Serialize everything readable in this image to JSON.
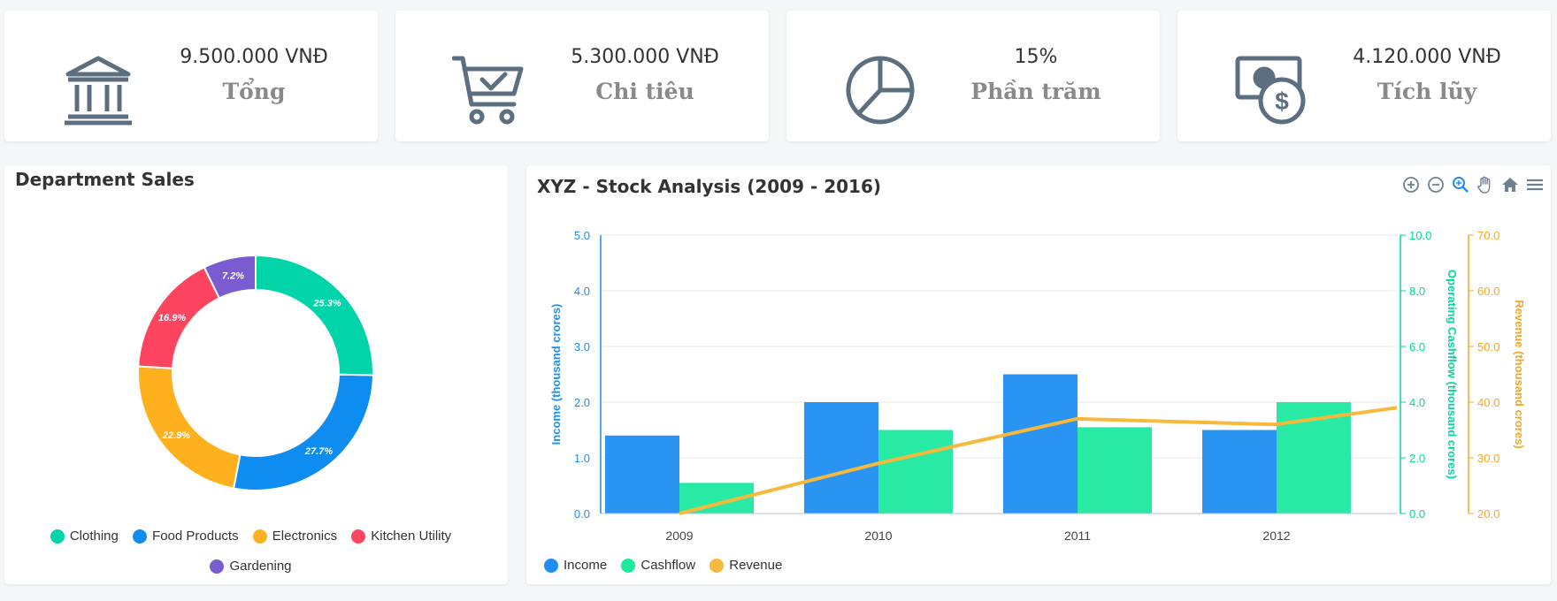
{
  "stats": [
    {
      "value": "9.500.000 VNĐ",
      "label": "Tổng",
      "icon": "bank-icon"
    },
    {
      "value": "5.300.000 VNĐ",
      "label": "Chi tiêu",
      "icon": "shopping-cart-icon"
    },
    {
      "value": "15%",
      "label": "Phần trăm",
      "icon": "pie-chart-icon"
    },
    {
      "value": "4.120.000 VNĐ",
      "label": "Tích lũy",
      "icon": "money-icon"
    }
  ],
  "colors": {
    "icon": "#5c6f80",
    "income": "#1f8ef1",
    "cashflow": "#1de9a0",
    "revenue": "#f6b93b",
    "cashflowAxis": "#00d99a",
    "revenueAxis": "#f5a623"
  },
  "donut": {
    "title": "Department Sales",
    "chart_data": {
      "type": "pie",
      "title": "Department Sales",
      "categories": [
        "Clothing",
        "Food Products",
        "Electronics",
        "Kitchen Utility",
        "Gardening"
      ],
      "values": [
        25.3,
        27.7,
        22.9,
        16.9,
        7.2
      ],
      "labels": [
        "25.3%",
        "27.7%",
        "22.9%",
        "16.9%",
        "7.2%"
      ],
      "colors": [
        "#00d4a8",
        "#0f8cf0",
        "#ffb01f",
        "#fe4560",
        "#7a5bd0"
      ],
      "legend_position": "bottom"
    }
  },
  "stock": {
    "title": "XYZ - Stock Analysis (2009 - 2016)",
    "chart_data": {
      "type": "bar",
      "title": "XYZ - Stock Analysis (2009 - 2016)",
      "categories": [
        "2009",
        "2010",
        "2011",
        "2012"
      ],
      "series": [
        {
          "name": "Income",
          "type": "bar",
          "axis": "income",
          "values": [
            1.4,
            2.0,
            2.5,
            1.5
          ]
        },
        {
          "name": "Cashflow",
          "type": "bar",
          "axis": "cashflow",
          "values": [
            1.1,
            3.0,
            3.1,
            4.0
          ]
        },
        {
          "name": "Revenue",
          "type": "line",
          "axis": "revenue",
          "values": [
            20,
            29,
            37,
            36,
            39
          ]
        }
      ],
      "axes": {
        "income": {
          "label": "Income (thousand crores)",
          "range": [
            0,
            5
          ],
          "ticks": [
            "0.0",
            "1.0",
            "2.0",
            "3.0",
            "4.0",
            "5.0"
          ]
        },
        "cashflow": {
          "label": "Operating Cashflow (thousand crores)",
          "range": [
            0,
            10
          ],
          "ticks": [
            "0.0",
            "2.0",
            "4.0",
            "6.0",
            "8.0",
            "10.0"
          ]
        },
        "revenue": {
          "label": "Revenue (thousand crores)",
          "range": [
            20,
            70
          ],
          "ticks": [
            "20.0",
            "30.0",
            "40.0",
            "50.0",
            "60.0",
            "70.0"
          ]
        }
      },
      "grid": true,
      "legend_position": "bottom-left"
    }
  }
}
